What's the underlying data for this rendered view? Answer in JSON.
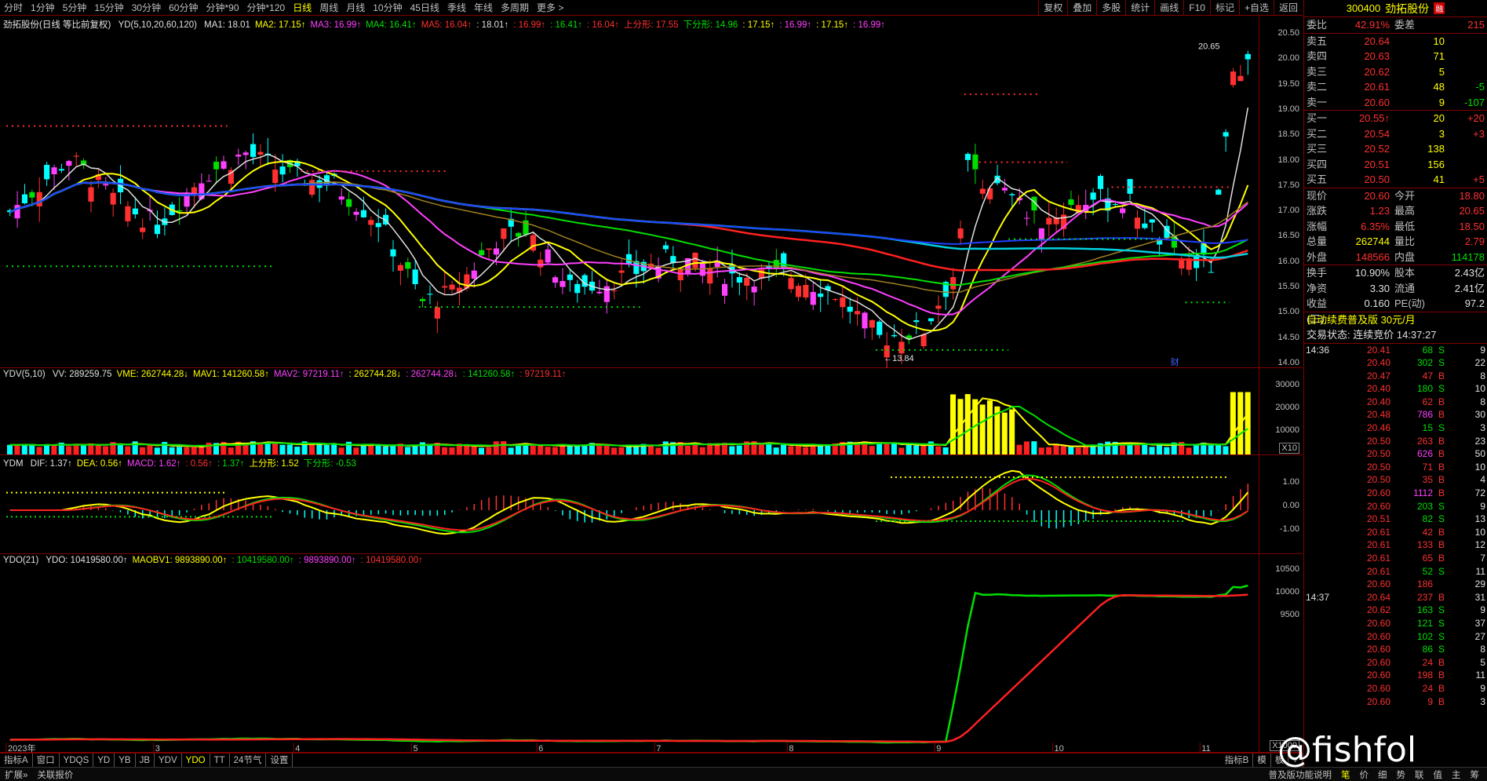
{
  "topbar": {
    "periods": [
      "分时",
      "1分钟",
      "5分钟",
      "15分钟",
      "30分钟",
      "60分钟",
      "分钟*90",
      "分钟*120",
      "日线",
      "周线",
      "月线",
      "10分钟",
      "45日线",
      "季线",
      "年线",
      "多周期",
      "更多 >"
    ],
    "active_period": "日线",
    "tools": [
      "复权",
      "叠加",
      "多股",
      "统计",
      "画线",
      "F10",
      "标记",
      "+自选",
      "返回"
    ]
  },
  "main_pane": {
    "title": "劲拓股份(日线 等比前复权)",
    "indicator": "YD(5,10,20,60,120)",
    "items": [
      {
        "t": "MA1: 18.01",
        "c": "#e0e0e0"
      },
      {
        "t": "MA2: 17.15↑",
        "c": "#ffff00"
      },
      {
        "t": "MA3: 16.99↑",
        "c": "#ff40ff"
      },
      {
        "t": "MA4: 16.41↑",
        "c": "#00e000"
      },
      {
        "t": "MA5: 16.04↑",
        "c": "#ff3030"
      },
      {
        "t": ": 18.01↑",
        "c": "#e0e0e0"
      },
      {
        "t": ": 16.99↑",
        "c": "#ff3030"
      },
      {
        "t": ": 16.41↑",
        "c": "#00e000"
      },
      {
        "t": ": 16.04↑",
        "c": "#ff3030"
      },
      {
        "t": "上分形: 17.55",
        "c": "#ff3030"
      },
      {
        "t": "下分形: 14.96",
        "c": "#00e000"
      },
      {
        "t": ": 17.15↑",
        "c": "#ffff00"
      },
      {
        "t": ": 16.99↑",
        "c": "#ff40ff"
      },
      {
        "t": ": 17.15↑",
        "c": "#ffff00"
      },
      {
        "t": ": 16.99↑",
        "c": "#ff40ff"
      }
    ],
    "y_ticks": [
      "20.50",
      "20.00",
      "19.50",
      "19.00",
      "18.50",
      "18.00",
      "17.50",
      "17.00",
      "16.50",
      "16.00",
      "15.50",
      "15.00",
      "14.50",
      "14.00"
    ],
    "high_label": "20.65",
    "low_label": "13.84",
    "finance_mark": "财"
  },
  "vol_pane": {
    "indicator": "YDV(5,10)",
    "items": [
      {
        "t": "VV: 289259.75",
        "c": "#e0e0e0"
      },
      {
        "t": "VME: 262744.28↓",
        "c": "#ffff00"
      },
      {
        "t": "MAV1: 141260.58↑",
        "c": "#ffff00"
      },
      {
        "t": "MAV2: 97219.11↑",
        "c": "#ff40ff"
      },
      {
        "t": ": 262744.28↓",
        "c": "#ffff00"
      },
      {
        "t": ": 262744.28↓",
        "c": "#ff40ff"
      },
      {
        "t": ": 141260.58↑",
        "c": "#00e000"
      },
      {
        "t": ": 97219.11↑",
        "c": "#ff3030"
      }
    ],
    "y_ticks": [
      "30000",
      "20000",
      "10000"
    ],
    "unit": "X10"
  },
  "macd_pane": {
    "indicator": "YDM",
    "items": [
      {
        "t": "DIF: 1.37↑",
        "c": "#e0e0e0"
      },
      {
        "t": "DEA: 0.56↑",
        "c": "#ffff00"
      },
      {
        "t": "MACD: 1.62↑",
        "c": "#ff40ff"
      },
      {
        "t": ": 0.56↑",
        "c": "#ff3030"
      },
      {
        "t": ": 1.37↑",
        "c": "#00e000"
      },
      {
        "t": "上分形: 1.52",
        "c": "#ffff00"
      },
      {
        "t": "下分形: -0.53",
        "c": "#00e000"
      }
    ],
    "y_ticks": [
      "1.00",
      "0.00",
      "-1.00"
    ]
  },
  "obv_pane": {
    "indicator": "YDO(21)",
    "items": [
      {
        "t": "YDO: 10419580.00↑",
        "c": "#e0e0e0"
      },
      {
        "t": "MAOBV1: 9893890.00↑",
        "c": "#ffff00"
      },
      {
        "t": ": 10419580.00↑",
        "c": "#00e000"
      },
      {
        "t": ": 9893890.00↑",
        "c": "#ff40ff"
      },
      {
        "t": ": 10419580.00↑",
        "c": "#ff3030"
      }
    ],
    "y_ticks": [
      "10500",
      "10000",
      "9500"
    ],
    "unit": "X1000"
  },
  "x_axis": {
    "labels": [
      "2023年",
      "3",
      "4",
      "5",
      "6",
      "7",
      "8",
      "9",
      "10",
      "11"
    ]
  },
  "bottombar": {
    "tabs": [
      "指标A",
      "窗口",
      "YDQS",
      "YD",
      "YB",
      "JB",
      "YDV",
      "YDO",
      "TT",
      "24节气",
      "设置"
    ],
    "active": "YDO",
    "right_tabs": [
      "指标B",
      "模",
      "板",
      "+"
    ]
  },
  "statusbar": {
    "left": [
      "扩展»",
      "关联报价"
    ],
    "right": [
      "普及版功能说明",
      "笔",
      "价",
      "细",
      "势",
      "联",
      "值",
      "主",
      "筹"
    ]
  },
  "quote": {
    "code": "300400",
    "name": "劲拓股份",
    "tag": "融",
    "weibi_label": "委比",
    "weibi": "42.91%",
    "weicha_label": "委差",
    "weicha": "215",
    "sells": [
      {
        "l": "卖五",
        "p": "20.64",
        "v": "10",
        "d": ""
      },
      {
        "l": "卖四",
        "p": "20.63",
        "v": "71",
        "d": ""
      },
      {
        "l": "卖三",
        "p": "20.62",
        "v": "5",
        "d": ""
      },
      {
        "l": "卖二",
        "p": "20.61",
        "v": "48",
        "d": "-5"
      },
      {
        "l": "卖一",
        "p": "20.60",
        "v": "9",
        "d": "-107"
      }
    ],
    "buys": [
      {
        "l": "买一",
        "p": "20.55↑",
        "v": "20",
        "d": "+20"
      },
      {
        "l": "买二",
        "p": "20.54",
        "v": "3",
        "d": "+3"
      },
      {
        "l": "买三",
        "p": "20.52",
        "v": "138",
        "d": ""
      },
      {
        "l": "买四",
        "p": "20.51",
        "v": "156",
        "d": ""
      },
      {
        "l": "买五",
        "p": "20.50",
        "v": "41",
        "d": "+5"
      }
    ],
    "stats": [
      {
        "l1": "现价",
        "v1": "20.60",
        "c1": "red",
        "l2": "今开",
        "v2": "18.80",
        "c2": "red"
      },
      {
        "l1": "涨跌",
        "v1": "1.23",
        "c1": "red",
        "l2": "最高",
        "v2": "20.65",
        "c2": "red"
      },
      {
        "l1": "涨幅",
        "v1": "6.35%",
        "c1": "red",
        "l2": "最低",
        "v2": "18.50",
        "c2": "red"
      },
      {
        "l1": "总量",
        "v1": "262744",
        "c1": "yellow",
        "l2": "量比",
        "v2": "2.79",
        "c2": "red"
      },
      {
        "l1": "外盘",
        "v1": "148566",
        "c1": "red",
        "l2": "内盘",
        "v2": "114178",
        "c2": "green"
      }
    ],
    "stats2": [
      {
        "l1": "换手",
        "v1": "10.90%",
        "l2": "股本",
        "v2": "2.43亿"
      },
      {
        "l1": "净资",
        "v1": "3.30",
        "l2": "流通",
        "v2": "2.41亿"
      },
      {
        "l1": "收益(三)",
        "v1": "0.160",
        "l2": "PE(动)",
        "v2": "97.2"
      }
    ],
    "promo": "自动续费普及版  30元/月",
    "trade_status": "交易状态: 连续竞价 14:37:27"
  },
  "ticks": [
    {
      "t": "14:36",
      "p": "20.41",
      "v": "68",
      "bs": "S",
      "n": "9"
    },
    {
      "t": "",
      "p": "20.40",
      "v": "302",
      "bs": "S",
      "n": "22"
    },
    {
      "t": "",
      "p": "20.47",
      "v": "47",
      "bs": "B",
      "n": "8"
    },
    {
      "t": "",
      "p": "20.40",
      "v": "180",
      "bs": "S",
      "n": "10"
    },
    {
      "t": "",
      "p": "20.40",
      "v": "62",
      "bs": "B",
      "n": "8"
    },
    {
      "t": "",
      "p": "20.48",
      "v": "786",
      "bs": "B",
      "n": "30"
    },
    {
      "t": "",
      "p": "20.46",
      "v": "15",
      "bs": "S",
      "n": "3"
    },
    {
      "t": "",
      "p": "20.50",
      "v": "263",
      "bs": "B",
      "n": "23"
    },
    {
      "t": "",
      "p": "20.50",
      "v": "626",
      "bs": "B",
      "n": "50"
    },
    {
      "t": "",
      "p": "20.50",
      "v": "71",
      "bs": "B",
      "n": "10"
    },
    {
      "t": "",
      "p": "20.50",
      "v": "35",
      "bs": "B",
      "n": "4"
    },
    {
      "t": "",
      "p": "20.60",
      "v": "1112",
      "bs": "B",
      "n": "72"
    },
    {
      "t": "",
      "p": "20.60",
      "v": "203",
      "bs": "S",
      "n": "9"
    },
    {
      "t": "",
      "p": "20.51",
      "v": "82",
      "bs": "S",
      "n": "13"
    },
    {
      "t": "",
      "p": "20.61",
      "v": "42",
      "bs": "B",
      "n": "10"
    },
    {
      "t": "",
      "p": "20.61",
      "v": "133",
      "bs": "B",
      "n": "12"
    },
    {
      "t": "",
      "p": "20.61",
      "v": "65",
      "bs": "B",
      "n": "7"
    },
    {
      "t": "",
      "p": "20.61",
      "v": "52",
      "bs": "S",
      "n": "11"
    },
    {
      "t": "",
      "p": "20.60",
      "v": "186",
      "bs": "",
      "n": "29"
    },
    {
      "t": "14:37",
      "p": "20.64",
      "v": "237",
      "bs": "B",
      "n": "31"
    },
    {
      "t": "",
      "p": "20.62",
      "v": "163",
      "bs": "S",
      "n": "9"
    },
    {
      "t": "",
      "p": "20.60",
      "v": "121",
      "bs": "S",
      "n": "37"
    },
    {
      "t": "",
      "p": "20.60",
      "v": "102",
      "bs": "S",
      "n": "27"
    },
    {
      "t": "",
      "p": "20.60",
      "v": "86",
      "bs": "S",
      "n": "8"
    },
    {
      "t": "",
      "p": "20.60",
      "v": "24",
      "bs": "B",
      "n": "5"
    },
    {
      "t": "",
      "p": "20.60",
      "v": "198",
      "bs": "B",
      "n": "11"
    },
    {
      "t": "",
      "p": "20.60",
      "v": "24",
      "bs": "B",
      "n": "9"
    },
    {
      "t": "",
      "p": "20.60",
      "v": "9",
      "bs": "B",
      "n": "3"
    }
  ],
  "watermark": "@fishfol",
  "colors": {
    "up": "#ff3030",
    "down": "#00ffff",
    "border": "#800000",
    "accent": "#ffff00"
  }
}
